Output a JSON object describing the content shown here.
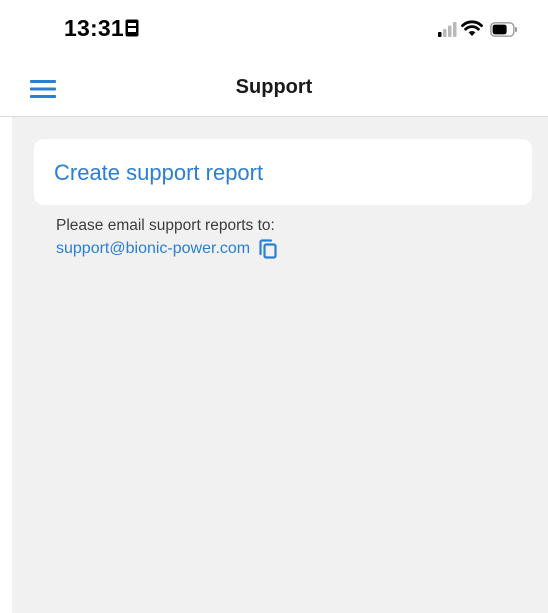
{
  "status_bar": {
    "time": "13:31",
    "icons": [
      "sim-card-icon",
      "cellular-signal-icon",
      "wifi-icon",
      "battery-icon"
    ]
  },
  "nav": {
    "title": "Support",
    "menu_icon": "hamburger-menu-icon"
  },
  "main": {
    "create_report_label": "Create support report",
    "email_prompt": "Please email support reports to:",
    "support_email": "support@bionic-power.com",
    "copy_icon": "copy-icon"
  },
  "colors": {
    "accent": "#2a7fd4",
    "background": "#f1f1f1",
    "card": "#ffffff"
  }
}
